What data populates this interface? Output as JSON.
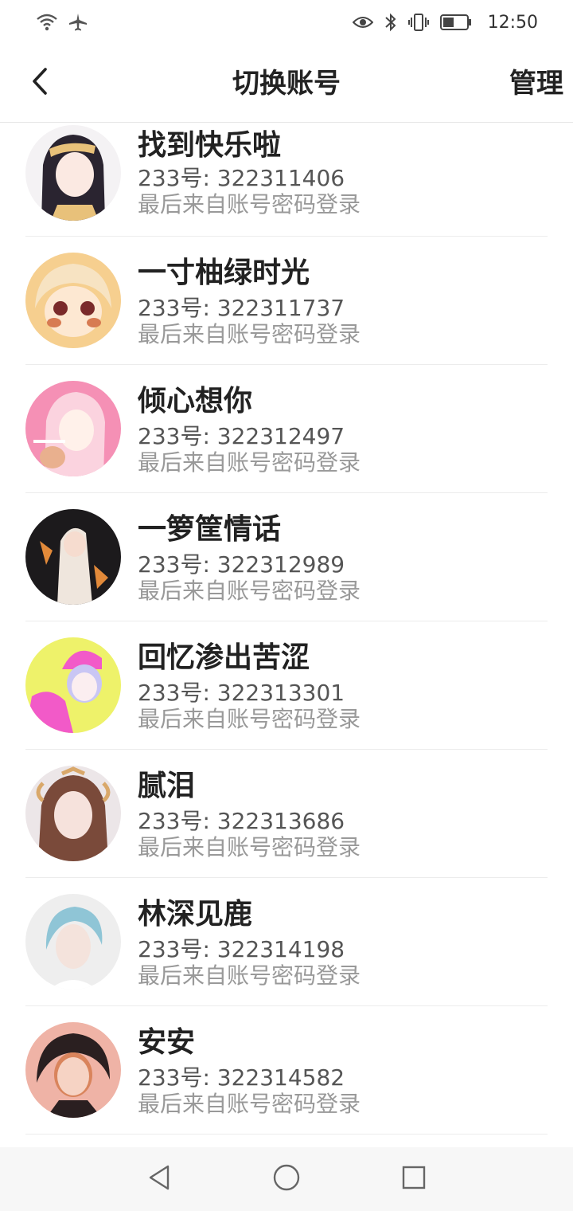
{
  "status_bar": {
    "time": "12:50",
    "left_icons": [
      "wifi-icon",
      "airplane-icon"
    ],
    "right_icons": [
      "eye-icon",
      "bluetooth-icon",
      "vibrate-icon",
      "battery-icon"
    ]
  },
  "header": {
    "back_icon": "chevron-left-icon",
    "title": "切换账号",
    "manage_label": "管理"
  },
  "accounts": [
    {
      "name": "找到快乐啦",
      "id_text": "233号: 322311406",
      "login_text": "最后来自账号密码登录",
      "avatar_colors": [
        "#f4f2f4",
        "#2a2430",
        "#e8c17a"
      ]
    },
    {
      "name": "一寸柚绿时光",
      "id_text": "233号: 322311737",
      "login_text": "最后来自账号密码登录",
      "avatar_colors": [
        "#f6cf8f",
        "#f7e3c2",
        "#d77b52"
      ]
    },
    {
      "name": "倾心想你",
      "id_text": "233号: 322312497",
      "login_text": "最后来自账号密码登录",
      "avatar_colors": [
        "#f590b5",
        "#fbd3df",
        "#e9b08e"
      ]
    },
    {
      "name": "一箩筐情话",
      "id_text": "233号: 322312989",
      "login_text": "最后来自账号密码登录",
      "avatar_colors": [
        "#1c1a1c",
        "#efe6dd",
        "#e28a3a"
      ]
    },
    {
      "name": "回忆渗出苦涩",
      "id_text": "233号: 322313301",
      "login_text": "最后来自账号密码登录",
      "avatar_colors": [
        "#eef26a",
        "#f25ac8",
        "#c9c6f4"
      ]
    },
    {
      "name": "腻泪",
      "id_text": "233号: 322313686",
      "login_text": "最后来自账号密码登录",
      "avatar_colors": [
        "#ece6e8",
        "#7a4a3a",
        "#d9a86a"
      ]
    },
    {
      "name": "林深见鹿",
      "id_text": "233号: 322314198",
      "login_text": "最后来自账号密码登录",
      "avatar_colors": [
        "#eeeeee",
        "#8fc5d6",
        "#f4e3dc"
      ]
    },
    {
      "name": "安安",
      "id_text": "233号: 322314582",
      "login_text": "最后来自账号密码登录",
      "avatar_colors": [
        "#efb3a6",
        "#2a1f20",
        "#d9845c"
      ]
    }
  ],
  "nav_bar": {
    "icons": [
      "nav-back-icon",
      "nav-home-icon",
      "nav-recents-icon"
    ]
  },
  "colors": {
    "text_primary": "#222222",
    "text_secondary": "#555555",
    "text_muted": "#999999",
    "divider": "#ececec",
    "nav_background": "#f7f7f7"
  }
}
